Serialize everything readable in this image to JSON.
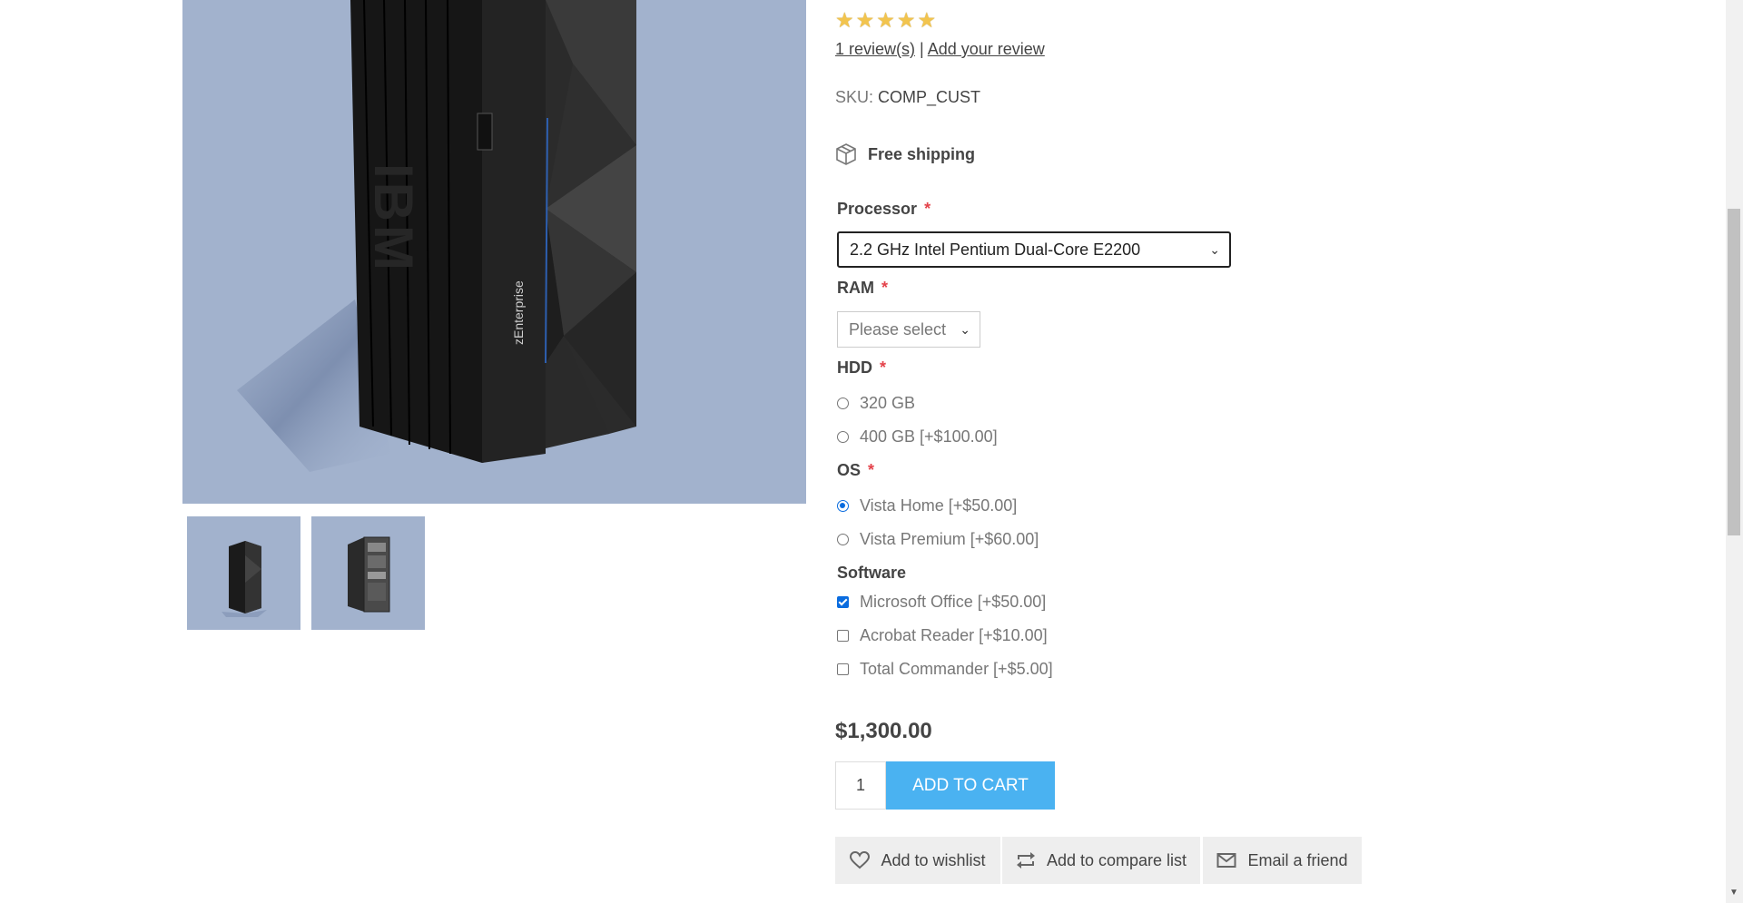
{
  "product": {
    "rating_stars": 5,
    "reviews_link": "1 review(s)",
    "separator": "|",
    "add_review_link": "Add your review",
    "sku_label": "SKU:",
    "sku_value": "COMP_CUST",
    "shipping": "Free shipping",
    "price": "$1,300.00",
    "quantity": "1",
    "add_to_cart": "ADD TO CART"
  },
  "attributes": {
    "processor": {
      "label": "Processor",
      "required": "*",
      "selected": "2.2 GHz Intel Pentium Dual-Core E2200"
    },
    "ram": {
      "label": "RAM",
      "required": "*",
      "selected": "Please select"
    },
    "hdd": {
      "label": "HDD",
      "required": "*",
      "options": [
        {
          "label": "320 GB",
          "checked": false
        },
        {
          "label": "400 GB [+$100.00]",
          "checked": false
        }
      ]
    },
    "os": {
      "label": "OS",
      "required": "*",
      "options": [
        {
          "label": "Vista Home [+$50.00]",
          "checked": true
        },
        {
          "label": "Vista Premium [+$60.00]",
          "checked": false
        }
      ]
    },
    "software": {
      "label": "Software",
      "options": [
        {
          "label": "Microsoft Office [+$50.00]",
          "checked": true
        },
        {
          "label": "Acrobat Reader [+$10.00]",
          "checked": false
        },
        {
          "label": "Total Commander [+$5.00]",
          "checked": false
        }
      ]
    }
  },
  "actions": {
    "wishlist": "Add to wishlist",
    "compare": "Add to compare list",
    "email": "Email a friend"
  },
  "images": {
    "brand_text": "IBM",
    "model_text": "zEnterprise"
  },
  "colors": {
    "accent": "#4ab2f1",
    "image_bg": "#a2b2cd",
    "required": "#e4434b",
    "star": "#f2c44e",
    "radio_checked": "#0a6cdf"
  },
  "icons": {
    "shipping": "package-icon",
    "wishlist": "heart-icon",
    "compare": "compare-arrows-icon",
    "email": "envelope-icon",
    "select": "chevron-down-icon"
  }
}
